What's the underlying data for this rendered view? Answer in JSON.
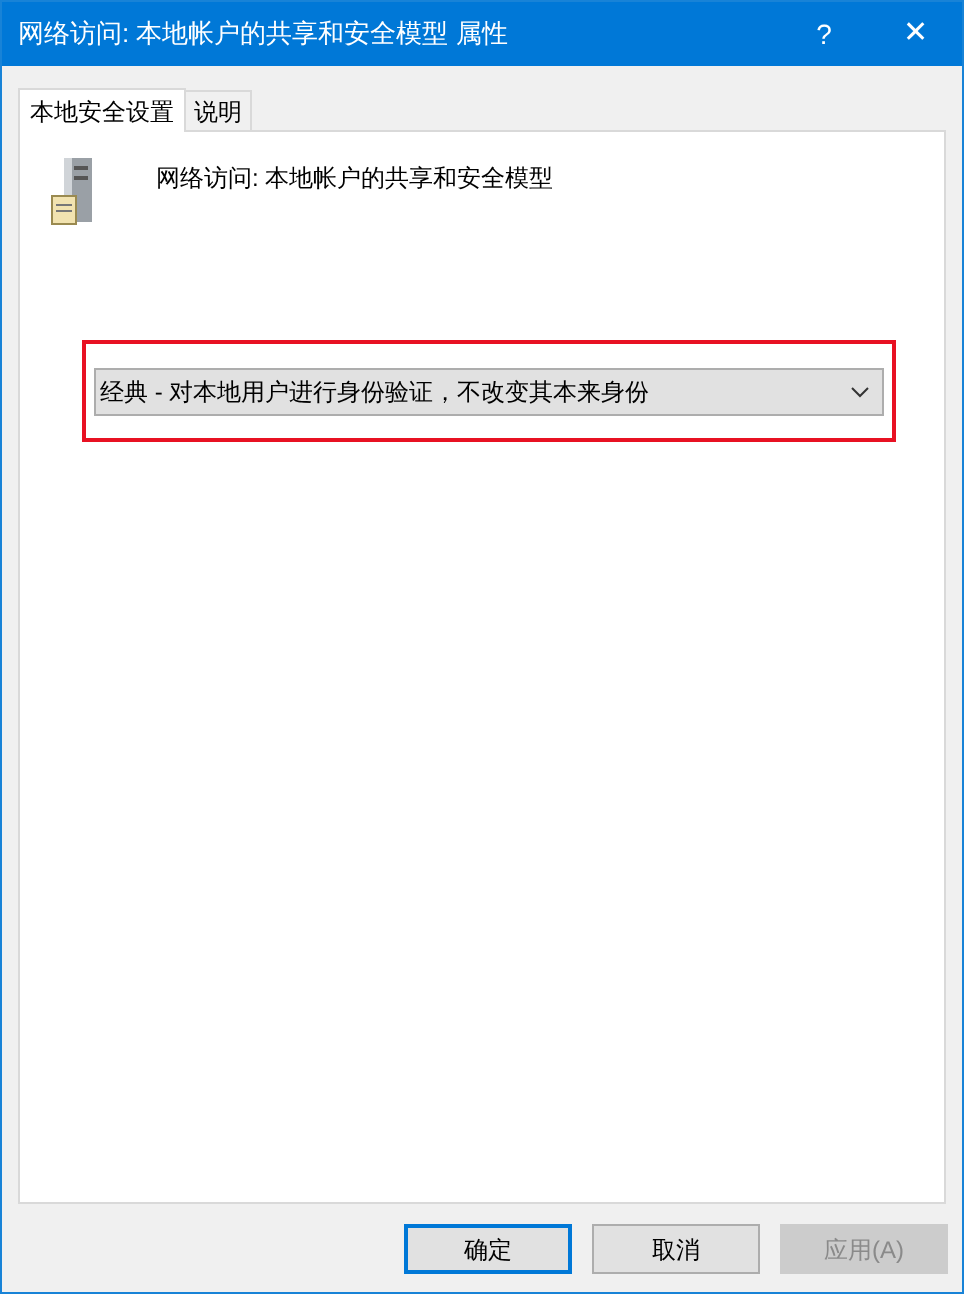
{
  "window": {
    "title": "网络访问: 本地帐户的共享和安全模型 属性",
    "help": "?",
    "close": "✕"
  },
  "tabs": [
    {
      "label": "本地安全设置",
      "selected": true
    },
    {
      "label": "说明",
      "selected": false
    }
  ],
  "policy": {
    "name": "网络访问: 本地帐户的共享和安全模型"
  },
  "dropdown": {
    "value": "经典 - 对本地用户进行身份验证，不改变其本来身份",
    "highlighted": true
  },
  "buttons": [
    {
      "label": "确定",
      "default": true,
      "disabled": false
    },
    {
      "label": "取消",
      "default": false,
      "disabled": false
    },
    {
      "label": "应用(A)",
      "default": false,
      "disabled": true
    }
  ]
}
